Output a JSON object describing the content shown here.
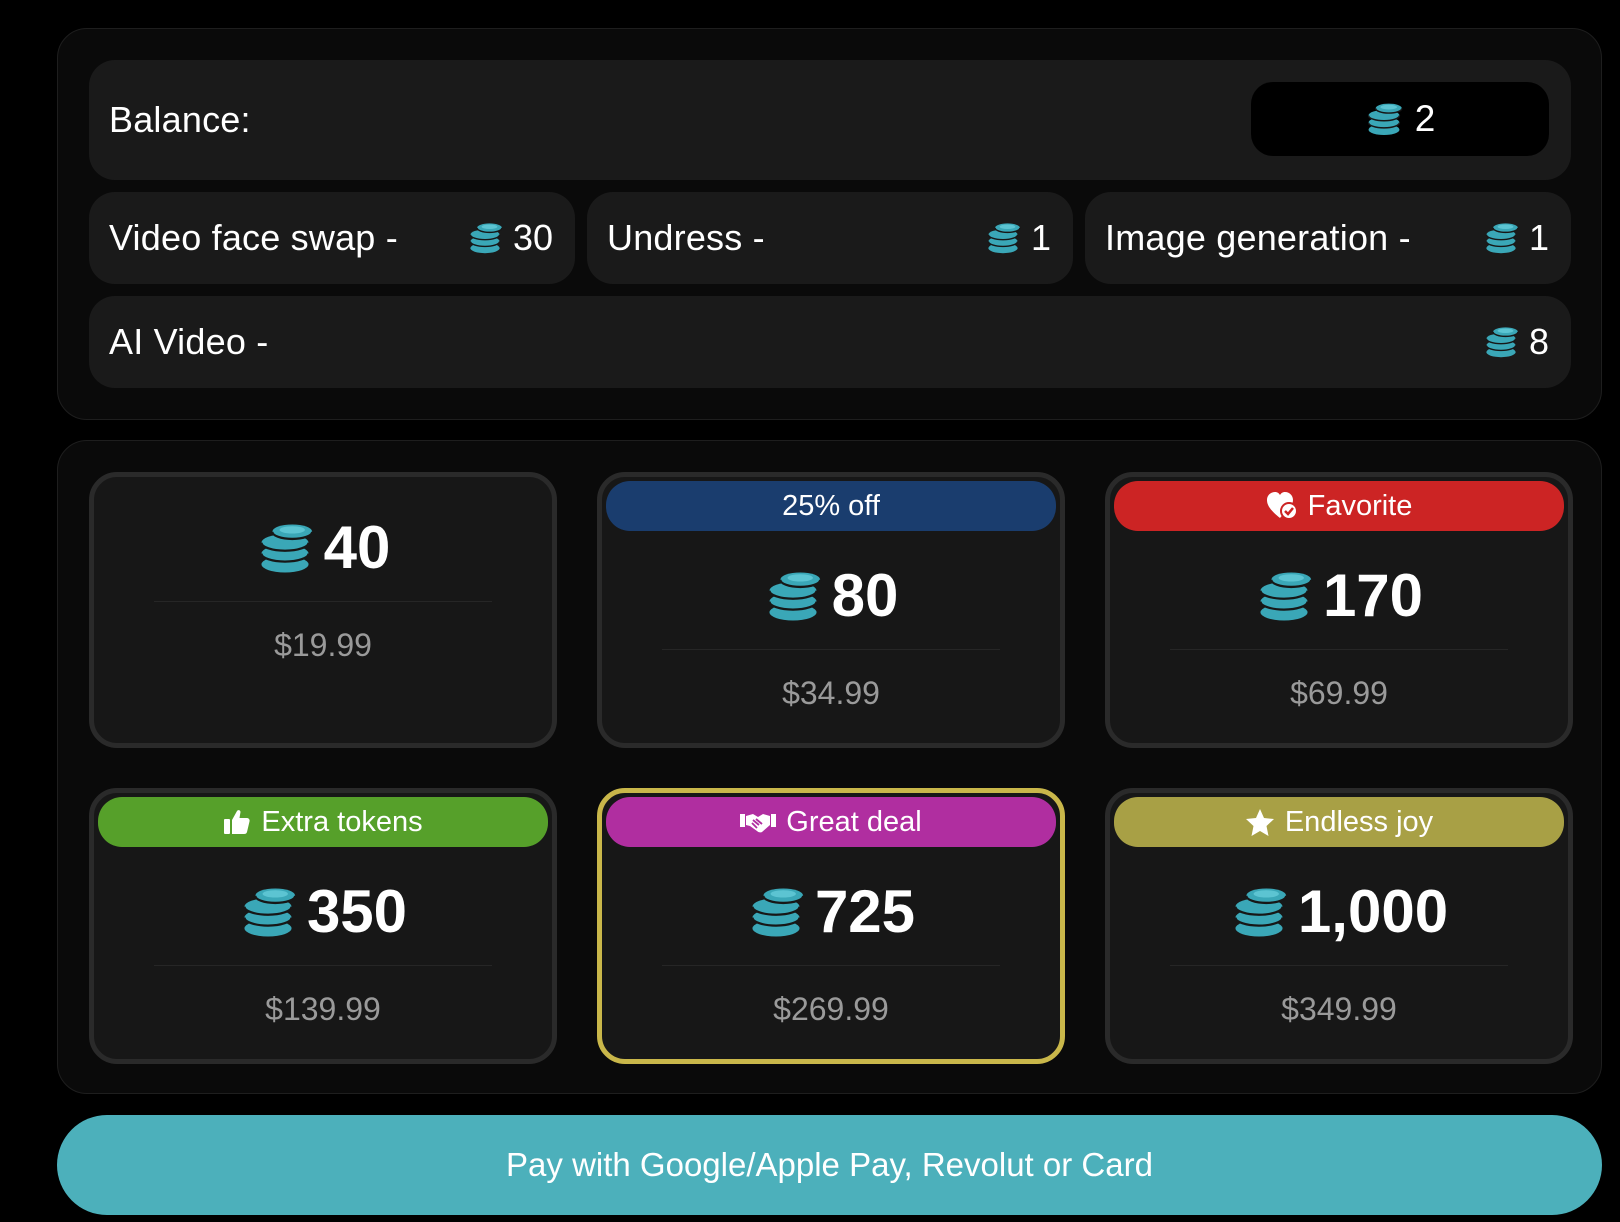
{
  "colors": {
    "coin": "#3aa7b7",
    "badge_discount": "#1a3d6e",
    "badge_favorite": "#cc2424",
    "badge_extra": "#56a02a",
    "badge_deal": "#b02ea0",
    "badge_joy": "#a8a045",
    "highlight_border": "#c9b74a",
    "pay_button": "#4cb0bb"
  },
  "balance": {
    "label": "Balance:",
    "value": "2",
    "icon": "coins-icon"
  },
  "costs": [
    {
      "label": "Video face swap -",
      "value": "30",
      "icon": "coins-icon"
    },
    {
      "label": "Undress -",
      "value": "1",
      "icon": "coins-icon"
    },
    {
      "label": "Image generation -",
      "value": "1",
      "icon": "coins-icon"
    },
    {
      "label": "AI Video -",
      "value": "8",
      "icon": "coins-icon"
    }
  ],
  "packages": [
    {
      "badge": "",
      "badge_icon": "",
      "amount": "40",
      "price": "$19.99",
      "selected": false
    },
    {
      "badge": "25% off",
      "badge_icon": "",
      "amount": "80",
      "price": "$34.99",
      "selected": false
    },
    {
      "badge": "Favorite",
      "badge_icon": "heart-check-icon",
      "amount": "170",
      "price": "$69.99",
      "selected": false
    },
    {
      "badge": "Extra tokens",
      "badge_icon": "thumbs-up-icon",
      "amount": "350",
      "price": "$139.99",
      "selected": false
    },
    {
      "badge": "Great deal",
      "badge_icon": "handshake-icon",
      "amount": "725",
      "price": "$269.99",
      "selected": true
    },
    {
      "badge": "Endless joy",
      "badge_icon": "star-icon",
      "amount": "1,000",
      "price": "$349.99",
      "selected": false
    }
  ],
  "pay_button": {
    "label": "Pay with Google/Apple Pay, Revolut or Card"
  }
}
